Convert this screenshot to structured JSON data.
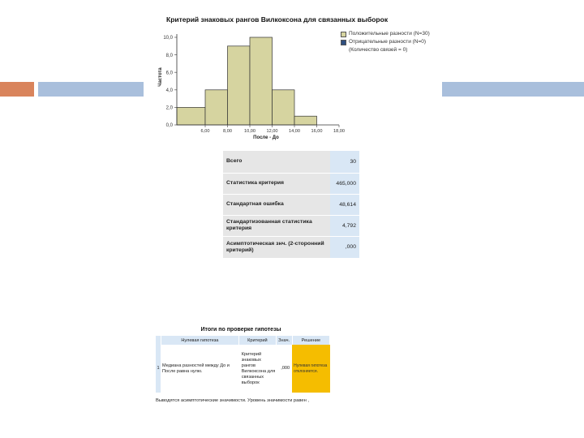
{
  "chart_data": {
    "type": "bar",
    "title": "Критерий знаковых рангов Вилкоксона для связанных выборок",
    "xlabel": "После - До",
    "ylabel": "Частота",
    "bin_edges": [
      0.0,
      6.0,
      8.0,
      10.0,
      12.0,
      14.0,
      16.0,
      18.0
    ],
    "x_tick_labels": [
      "6,00",
      "8,00",
      "10,00",
      "12,00",
      "14,00",
      "16,00",
      "18,00"
    ],
    "y_tick_labels": [
      "0,0",
      "2,0",
      "4,0",
      "6,0",
      "8,0",
      "10,0"
    ],
    "xlim": [
      6.0,
      18.0
    ],
    "ylim": [
      0,
      10
    ],
    "series": [
      {
        "name": "Положительные разности (N=30)",
        "color": "#d6d4a0",
        "bins": [
          {
            "x0": 6.0,
            "x1": 8.0,
            "value": 2
          },
          {
            "x0": 8.0,
            "x1": 10.0,
            "value": 4
          },
          {
            "x0": 10.0,
            "x1": 12.0,
            "value": 9
          },
          {
            "x0": 12.0,
            "x1": 14.0,
            "value": 10
          },
          {
            "x0": 14.0,
            "x1": 16.0,
            "value": 4
          },
          {
            "x0": 16.0,
            "x1": 18.0,
            "value": 1
          }
        ]
      },
      {
        "name": "Отрицательные разности (N=0)",
        "color": "#2f4f7f",
        "bins": []
      }
    ],
    "legend": {
      "position": "right",
      "note": "(Количество связей = 0)"
    }
  },
  "stats": {
    "rows": [
      {
        "label": "Всего",
        "value": "30"
      },
      {
        "label": "Статистика критерия",
        "value": "465,000"
      },
      {
        "label": "Стандартная ошибка",
        "value": "48,614"
      },
      {
        "label": "Стандартизованная статистика критерия",
        "value": "4,792"
      },
      {
        "label": "Асимптотическая знч. (2-сторонний критерий)",
        "value": ",000"
      }
    ]
  },
  "hypothesis": {
    "title": "Итоги по проверке гипотезы",
    "headers": {
      "null": "Нулевая гипотеза",
      "test": "Критерий",
      "sig": "Знач.",
      "decision": "Решение"
    },
    "row": {
      "num": "1",
      "null": "Медиана разностей между До и После равна нулю.",
      "test": "Критерий знаковых рангов Вилкоксона для связанных выборок",
      "sig": ",000",
      "decision": "Нулевая гипотеза отклоняется."
    },
    "footer": "Выводятся асимптотические значимости. Уровень значимости равен ,"
  },
  "colors": {
    "accent_orange": "#d9845c",
    "accent_blue": "#a9bfdc",
    "decision_highlight": "#f5bd00"
  }
}
